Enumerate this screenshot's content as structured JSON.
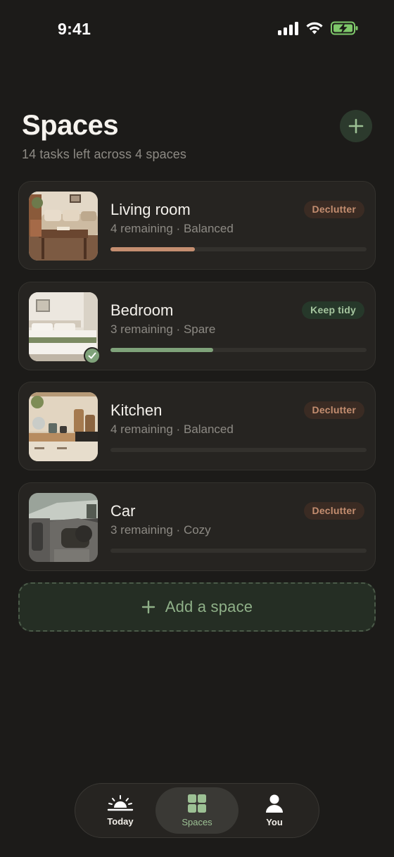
{
  "status_bar": {
    "time": "9:41"
  },
  "header": {
    "title": "Spaces",
    "subtitle": "14 tasks left across 4 spaces",
    "add_icon": "plus-icon"
  },
  "colors": {
    "background": "#1c1b19",
    "card": "#262421",
    "accent_green": "#7fa27a",
    "accent_clay": "#c48e70"
  },
  "spaces": [
    {
      "name": "Living room",
      "remaining": "4 remaining",
      "level": "Balanced",
      "mode": "Declutter",
      "progress": 0.33,
      "progress_color": "#c48e70",
      "done": false
    },
    {
      "name": "Bedroom",
      "remaining": "3 remaining",
      "level": "Spare",
      "mode": "Keep tidy",
      "progress": 0.4,
      "progress_color": "#7fa27a",
      "done": true
    },
    {
      "name": "Kitchen",
      "remaining": "4 remaining",
      "level": "Balanced",
      "mode": "Declutter",
      "progress": 0,
      "progress_color": "#c48e70",
      "done": false
    },
    {
      "name": "Car",
      "remaining": "3 remaining",
      "level": "Cozy",
      "mode": "Declutter",
      "progress": 0,
      "progress_color": "#c48e70",
      "done": false
    }
  ],
  "meta_separator": " · ",
  "add_space": {
    "label": "Add a space"
  },
  "tabs": [
    {
      "label": "Today",
      "icon": "sunrise-icon",
      "active": false
    },
    {
      "label": "Spaces",
      "icon": "grid-icon",
      "active": true
    },
    {
      "label": "You",
      "icon": "person-icon",
      "active": false
    }
  ]
}
